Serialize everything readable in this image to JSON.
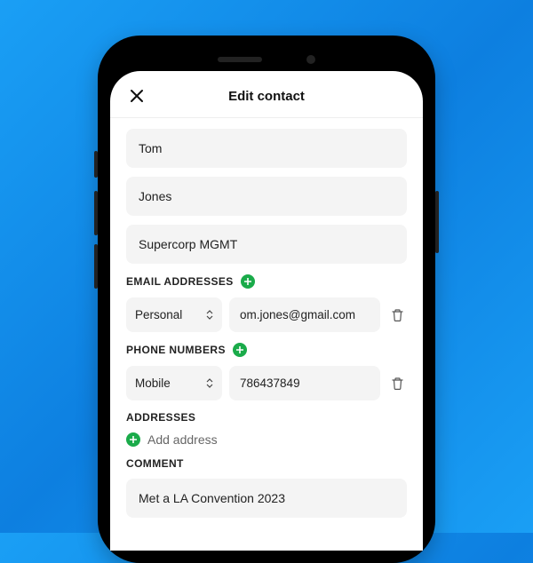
{
  "header": {
    "title": "Edit contact"
  },
  "name": {
    "first": "Tom",
    "last": "Jones",
    "company": "Supercorp MGMT"
  },
  "sections": {
    "emails_label": "EMAIL ADDRESSES",
    "phones_label": "PHONE NUMBERS",
    "addresses_label": "ADDRESSES",
    "comment_label": "COMMENT"
  },
  "emails": [
    {
      "type": "Personal",
      "value": "om.jones@gmail.com"
    }
  ],
  "phones": [
    {
      "type": "Mobile",
      "value": "786437849"
    }
  ],
  "addresses": {
    "add_label": "Add address"
  },
  "comment": {
    "value": "Met a LA Convention 2023"
  },
  "colors": {
    "accent": "#1aab4a"
  }
}
